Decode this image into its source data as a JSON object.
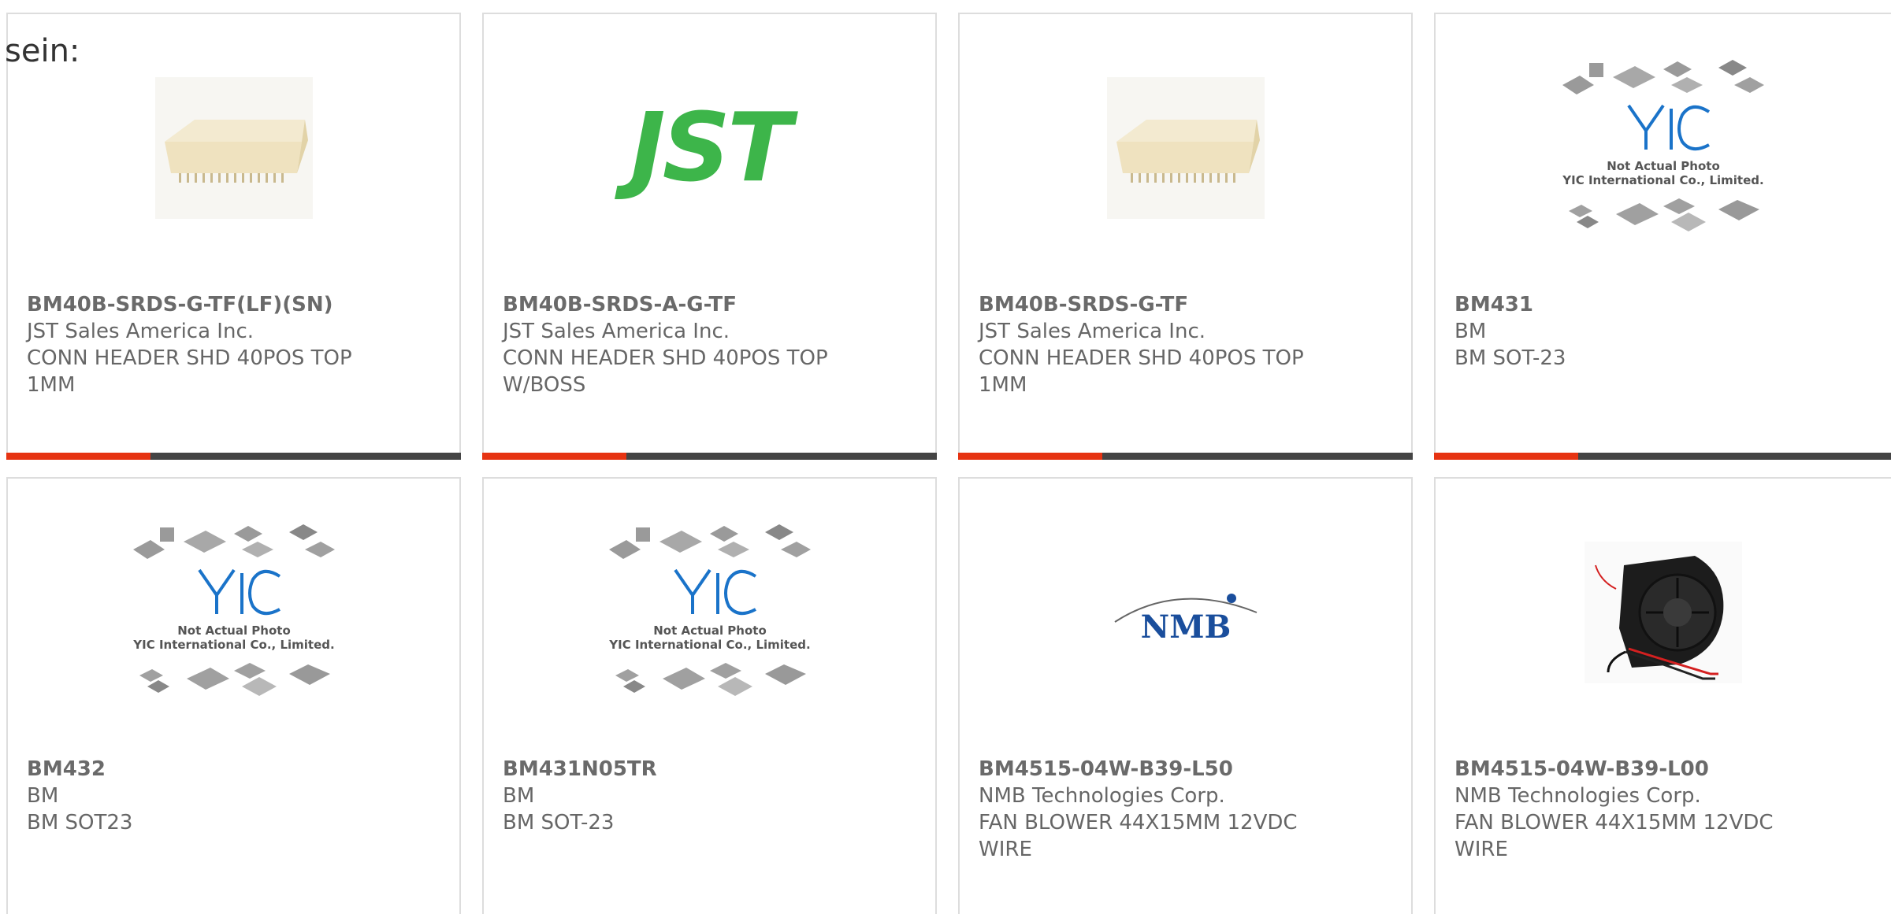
{
  "heading": "sein:",
  "colors": {
    "accent": "#e63312",
    "bar": "#444444",
    "jst_green": "#3db54a",
    "nmb_blue": "#1a4e9c",
    "yic_blue": "#1a73c9"
  },
  "products": [
    {
      "part_number": "BM40B-SRDS-G-TF(LF)(SN)",
      "manufacturer": "JST Sales America Inc.",
      "description_line1": "CONN HEADER SHD 40POS TOP",
      "description_line2": "1MM",
      "image": "connector-photo"
    },
    {
      "part_number": "BM40B-SRDS-A-G-TF",
      "manufacturer": "JST Sales America Inc.",
      "description_line1": "CONN HEADER SHD 40POS TOP",
      "description_line2": "W/BOSS",
      "image": "jst-logo",
      "logo_text": "JST"
    },
    {
      "part_number": "BM40B-SRDS-G-TF",
      "manufacturer": "JST Sales America Inc.",
      "description_line1": "CONN HEADER SHD 40POS TOP",
      "description_line2": "1MM",
      "image": "connector-photo"
    },
    {
      "part_number": "BM431",
      "manufacturer": "BM",
      "description_line1": "BM SOT-23",
      "description_line2": "",
      "image": "yic-placeholder",
      "placeholder_line1": "Not Actual Photo",
      "placeholder_line2": "YIC International Co., Limited."
    },
    {
      "part_number": "BM432",
      "manufacturer": "BM",
      "description_line1": "BM SOT23",
      "description_line2": "",
      "image": "yic-placeholder",
      "placeholder_line1": "Not Actual Photo",
      "placeholder_line2": "YIC International Co., Limited."
    },
    {
      "part_number": "BM431N05TR",
      "manufacturer": "BM",
      "description_line1": "BM SOT-23",
      "description_line2": "",
      "image": "yic-placeholder",
      "placeholder_line1": "Not Actual Photo",
      "placeholder_line2": "YIC International Co., Limited."
    },
    {
      "part_number": "BM4515-04W-B39-L50",
      "manufacturer": "NMB Technologies Corp.",
      "description_line1": "FAN BLOWER 44X15MM 12VDC",
      "description_line2": "WIRE",
      "image": "nmb-logo",
      "logo_text": "NMB"
    },
    {
      "part_number": "BM4515-04W-B39-L00",
      "manufacturer": "NMB Technologies Corp.",
      "description_line1": "FAN BLOWER 44X15MM 12VDC",
      "description_line2": "WIRE",
      "image": "blower-fan-photo"
    }
  ]
}
